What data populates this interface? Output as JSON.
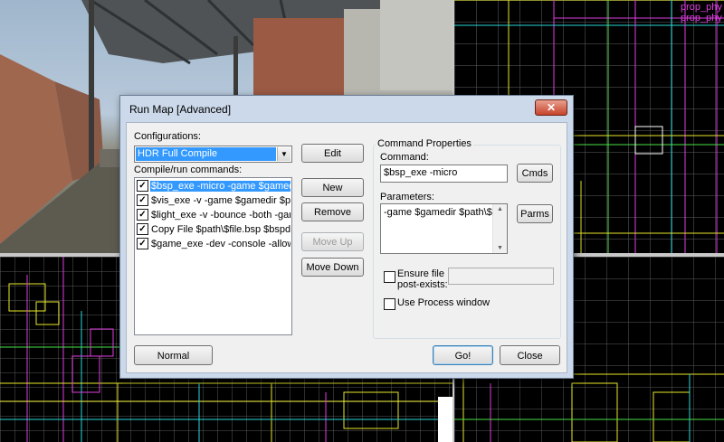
{
  "viewports": {
    "labels": [
      "prop_phy",
      "prop_phy"
    ],
    "colors": {
      "selection": "#e03ee0",
      "wire_yellow": "#e8e82a",
      "wire_cyan": "#28d8d8",
      "wire_green": "#48e048",
      "grid": "#5a5a5a"
    }
  },
  "dialog": {
    "title": "Run Map [Advanced]",
    "close_glyph": "✕",
    "configurations_label": "Configurations:",
    "configuration_value": "HDR Full Compile",
    "commands_label": "Compile/run commands:",
    "commands": [
      {
        "text": "$bsp_exe -micro -game $gamedir $pa",
        "checked": true,
        "selected": true
      },
      {
        "text": "$vis_exe -v -game $gamedir $path\\$f",
        "checked": true,
        "selected": false
      },
      {
        "text": "$light_exe -v -bounce -both -game $g",
        "checked": true,
        "selected": false
      },
      {
        "text": "Copy File $path\\$file.bsp $bspdir\\$file",
        "checked": true,
        "selected": false
      },
      {
        "text": "$game_exe -dev -console -allowdebu",
        "checked": true,
        "selected": false
      }
    ],
    "buttons": {
      "edit": "Edit",
      "new": "New",
      "remove": "Remove",
      "move_up": "Move Up",
      "move_down": "Move Down",
      "normal": "Normal",
      "go": "Go!",
      "close": "Close",
      "cmds": "Cmds",
      "parms": "Parms"
    },
    "command_properties": {
      "group_label": "Command Properties",
      "command_label": "Command:",
      "command_value": "$bsp_exe -micro",
      "parameters_label": "Parameters:",
      "parameters_value": "-game $gamedir $path\\$file",
      "ensure_file_label_1": "Ensure file",
      "ensure_file_label_2": "post-exists:",
      "ensure_file_value": "",
      "ensure_file_checked": false,
      "use_process_label": "Use Process window",
      "use_process_checked": false
    }
  }
}
